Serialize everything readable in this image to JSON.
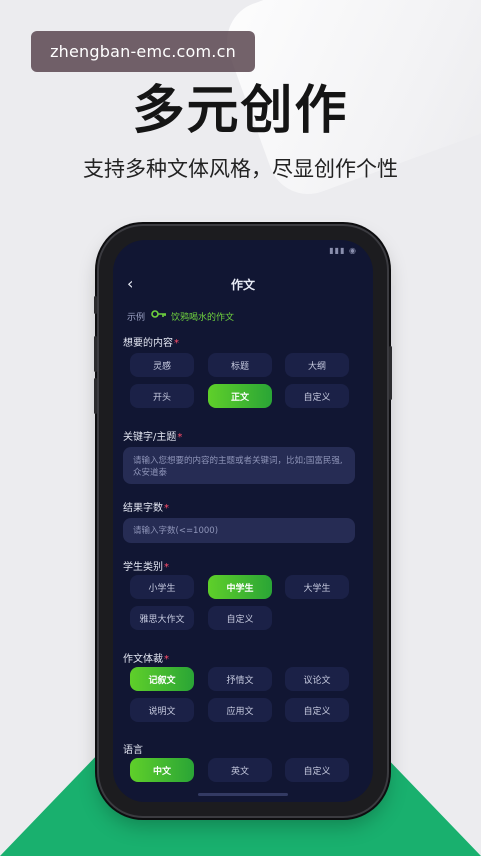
{
  "watermark": "zhengban-emc.com.cn",
  "headline": "多元创作",
  "subline": "支持多种文体风格，尽显创作个性",
  "phone": {
    "status_right": "▮▮▮ ◉",
    "nav_title": "作文",
    "back_glyph": "‹",
    "example_label": "示例",
    "example_link": "饮鸦喝水的作文",
    "sections": {
      "content": {
        "label": "想要的内容",
        "required": "*",
        "options": [
          "灵感",
          "标题",
          "大纲",
          "开头",
          "正文",
          "自定义"
        ],
        "selected": "正文"
      },
      "keywords": {
        "label": "关键字/主题",
        "required": "*",
        "placeholder": "请输入您想要的内容的主题或者关键词，比如;国富民强,众安道泰"
      },
      "word_count": {
        "label": "结果字数",
        "required": "*",
        "placeholder": "请输入字数(<=1000)"
      },
      "student": {
        "label": "学生类别",
        "required": "*",
        "options": [
          "小学生",
          "中学生",
          "大学生",
          "雅思大作文",
          "自定义"
        ],
        "selected": "中学生"
      },
      "genre": {
        "label": "作文体裁",
        "required": "*",
        "options": [
          "记叙文",
          "抒情文",
          "议论文",
          "说明文",
          "应用文",
          "自定义"
        ],
        "selected": "记叙文"
      },
      "language": {
        "label": "语言",
        "options": [
          "中文",
          "英文",
          "自定义"
        ],
        "selected": "中文"
      }
    }
  },
  "colors": {
    "accent_green": "#3fbf2f",
    "screen_bg": "#111633",
    "chip_bg": "#1b2147",
    "required_mark": "#ff4d6a",
    "page_green": "#19b06e"
  }
}
